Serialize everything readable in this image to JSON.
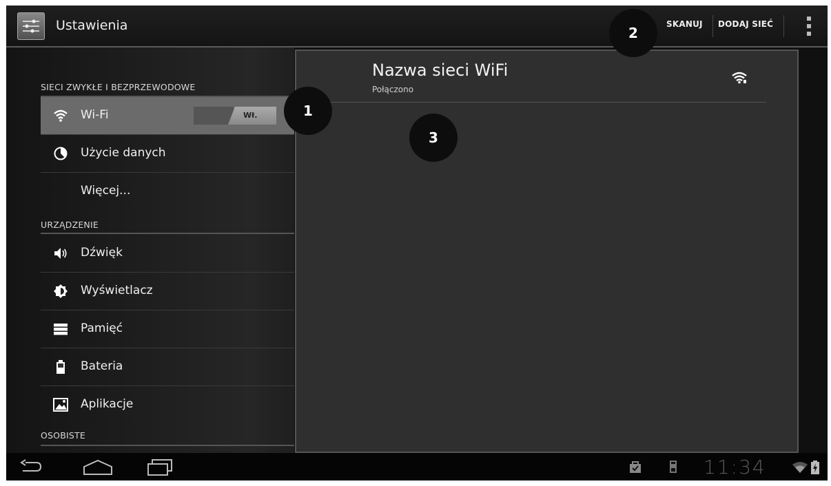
{
  "actionbar": {
    "title": "Ustawienia",
    "scan_label": "SKANUJ",
    "add_network_label": "DODAJ SIEĆ",
    "icon": "settings-sliders-icon",
    "overflow_icon": "overflow-menu-icon"
  },
  "sidebar": {
    "sections": [
      {
        "header": "SIECI ZWYKŁE I BEZPRZEWODOWE"
      },
      {
        "header": "URZĄDZENIE"
      },
      {
        "header": "OSOBISTE"
      }
    ],
    "items": [
      {
        "label": "Wi-Fi",
        "icon": "wifi-icon",
        "selected": true
      },
      {
        "label": "Użycie danych",
        "icon": "data-usage-icon"
      },
      {
        "label": "Więcej...",
        "icon": ""
      },
      {
        "label": "Dźwięk",
        "icon": "speaker-icon"
      },
      {
        "label": "Wyświetlacz",
        "icon": "brightness-icon"
      },
      {
        "label": "Pamięć",
        "icon": "storage-icon"
      },
      {
        "label": "Bateria",
        "icon": "battery-icon"
      },
      {
        "label": "Aplikacje",
        "icon": "apps-icon"
      }
    ],
    "wifi_toggle": {
      "state_label": "Wł.",
      "on": true
    }
  },
  "detail": {
    "network_name": "Nazwa sieci WiFi",
    "network_status": "Połączono",
    "signal_icon": "wifi-signal-icon"
  },
  "callouts": [
    "1",
    "2",
    "3"
  ],
  "navbar": {
    "back_icon": "back-icon",
    "home_icon": "home-icon",
    "recents_icon": "recent-apps-icon"
  },
  "statusbar": {
    "time": "11:34",
    "icons": [
      "shopping-bag-icon",
      "usb-icon",
      "wifi-status-icon",
      "battery-charging-icon"
    ]
  },
  "colors": {
    "background": "#101010",
    "selected_item": "#6b6b6b",
    "detail_pane": "#2f2f2f",
    "clock": "#5a5a5a"
  }
}
